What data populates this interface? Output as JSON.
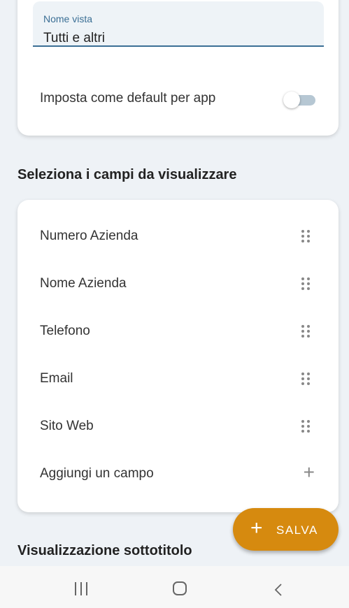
{
  "view_name": {
    "label": "Nome vista",
    "value": "Tutti e altri"
  },
  "default_switch": {
    "label": "Imposta come default per app",
    "on": false
  },
  "fields_section": {
    "title": "Seleziona i campi da visualizzare",
    "items": [
      {
        "label": "Numero Azienda",
        "icon": "drag-handle-icon"
      },
      {
        "label": "Nome Azienda",
        "icon": "drag-handle-icon"
      },
      {
        "label": "Telefono",
        "icon": "drag-handle-icon"
      },
      {
        "label": "Email",
        "icon": "drag-handle-icon"
      },
      {
        "label": "Sito Web",
        "icon": "drag-handle-icon"
      }
    ],
    "add_field_label": "Aggiungi un campo"
  },
  "subtitle_section": {
    "title": "Visualizzazione sottotitolo"
  },
  "fab": {
    "label": "SALVA",
    "color": "#d68a0f"
  },
  "colors": {
    "background": "#eef2f6",
    "accent": "#3b6f95"
  }
}
